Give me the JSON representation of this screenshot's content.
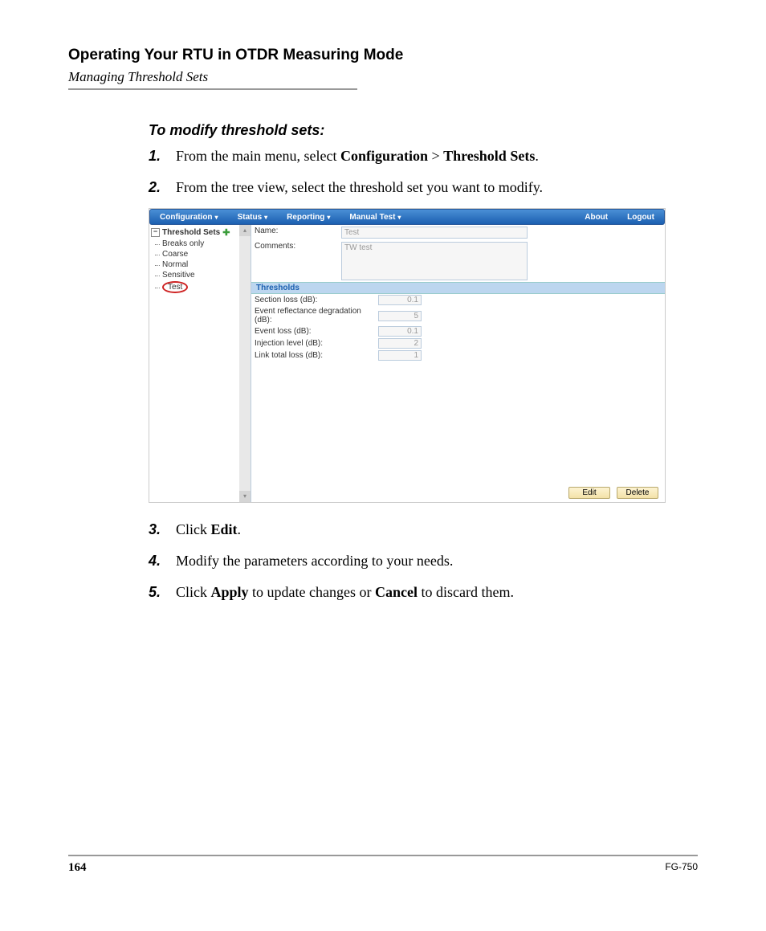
{
  "header": {
    "chapter": "Operating Your RTU in OTDR Measuring Mode",
    "section": "Managing Threshold Sets"
  },
  "procedure": {
    "heading": "To modify threshold sets:",
    "step1_num": "1.",
    "step1_a": "From the main menu, select ",
    "step1_b": "Configuration",
    "step1_c": " > ",
    "step1_d": "Threshold Sets",
    "step1_e": ".",
    "step2_num": "2.",
    "step2": "From the tree view, select the threshold set you want to modify.",
    "step3_num": "3.",
    "step3_a": "Click ",
    "step3_b": "Edit",
    "step3_c": ".",
    "step4_num": "4.",
    "step4": "Modify the parameters according to your needs.",
    "step5_num": "5.",
    "step5_a": "Click ",
    "step5_b": "Apply",
    "step5_c": " to update changes or ",
    "step5_d": "Cancel",
    "step5_e": " to discard them."
  },
  "ui": {
    "menubar": {
      "configuration": "Configuration",
      "status": "Status",
      "reporting": "Reporting",
      "manual_test": "Manual Test",
      "about": "About",
      "logout": "Logout"
    },
    "tree": {
      "root": "Threshold Sets",
      "items": [
        "Breaks only",
        "Coarse",
        "Normal",
        "Sensitive",
        "Test"
      ]
    },
    "form": {
      "name_label": "Name:",
      "name_value": "Test",
      "comments_label": "Comments:",
      "comments_value": "TW test",
      "thresholds_header": "Thresholds",
      "rows": [
        {
          "label": "Section loss (dB):",
          "value": "0.1"
        },
        {
          "label": "Event reflectance degradation (dB):",
          "value": "5"
        },
        {
          "label": "Event loss (dB):",
          "value": "0.1"
        },
        {
          "label": "Injection level (dB):",
          "value": "2"
        },
        {
          "label": "Link total loss (dB):",
          "value": "1"
        }
      ],
      "edit_button": "Edit",
      "delete_button": "Delete"
    }
  },
  "footer": {
    "page": "164",
    "model": "FG-750"
  }
}
